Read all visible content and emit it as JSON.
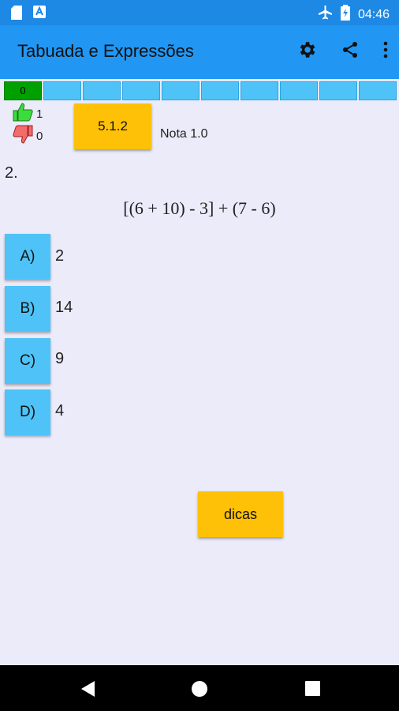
{
  "status_bar": {
    "time": "04:46"
  },
  "app_bar": {
    "title": "Tabuada e Expressões"
  },
  "progress": {
    "segments": [
      "0",
      "",
      "",
      "",
      "",
      "",
      "",
      "",
      "",
      ""
    ],
    "current_index": 0
  },
  "score": {
    "correct": "1",
    "wrong": "0"
  },
  "level": {
    "label": "5.1.2"
  },
  "grade": {
    "text": "Nota 1.0"
  },
  "question": {
    "number": "2.",
    "expression": "[(6 + 10) - 3] + (7 - 6)",
    "options": [
      {
        "letter": "A)",
        "value": "2"
      },
      {
        "letter": "B)",
        "value": "14"
      },
      {
        "letter": "C)",
        "value": "9"
      },
      {
        "letter": "D)",
        "value": "4"
      }
    ]
  },
  "tips": {
    "label": "dicas"
  }
}
